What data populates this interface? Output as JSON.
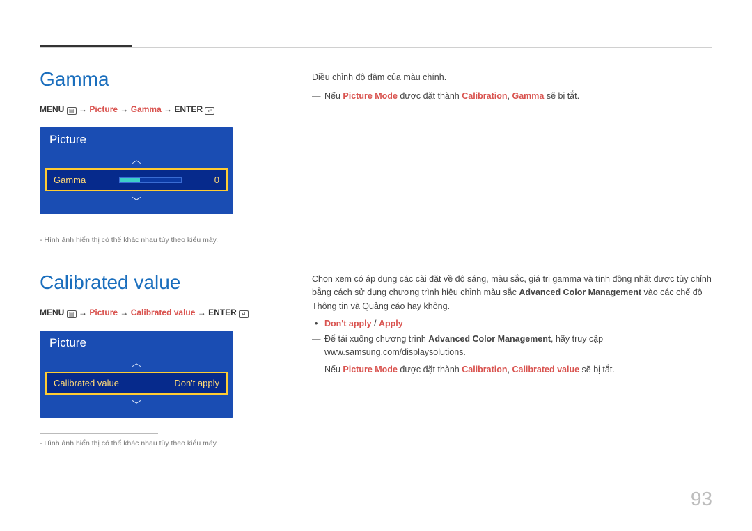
{
  "page_number": "93",
  "section1": {
    "heading": "Gamma",
    "nav": {
      "menu": "MENU",
      "p1": "Picture",
      "p2": "Gamma",
      "enter": "ENTER"
    },
    "osd": {
      "title": "Picture",
      "item_label": "Gamma",
      "item_value": "0"
    },
    "note": "Hình ảnh hiển thị có thể khác nhau tùy theo kiểu máy.",
    "desc": "Điều chỉnh độ đậm của màu chính.",
    "dash1_pre": "Nếu ",
    "dash1_b1": "Picture Mode",
    "dash1_mid": " được đặt thành ",
    "dash1_b2": "Calibration",
    "dash1_sep": ", ",
    "dash1_b3": "Gamma",
    "dash1_post": " sẽ bị tắt."
  },
  "section2": {
    "heading": "Calibrated value",
    "nav": {
      "menu": "MENU",
      "p1": "Picture",
      "p2": "Calibrated value",
      "enter": "ENTER"
    },
    "osd": {
      "title": "Picture",
      "item_label": "Calibrated value",
      "item_value": "Don't apply"
    },
    "note": "Hình ảnh hiển thị có thể khác nhau tùy theo kiểu máy.",
    "desc_pre": "Chọn xem có áp dụng các cài đặt về độ sáng, màu sắc, giá trị gamma và tính đồng nhất được tùy chỉnh bằng cách sử dụng chương trình hiệu chỉnh màu sắc ",
    "desc_b": "Advanced Color Management",
    "desc_post": " vào các chế độ Thông tin và Quảng cáo hay không.",
    "bullet_opt1": "Don't apply",
    "bullet_sep": " / ",
    "bullet_opt2": "Apply",
    "dash1_pre": "Để tải xuống chương trình ",
    "dash1_b": "Advanced Color Management",
    "dash1_post": ", hãy truy cập www.samsung.com/displaysolutions.",
    "dash2_pre": "Nếu ",
    "dash2_b1": "Picture Mode",
    "dash2_mid": " được đặt thành ",
    "dash2_b2": "Calibration",
    "dash2_sep": ", ",
    "dash2_b3": "Calibrated value",
    "dash2_post": " sẽ bị tắt."
  }
}
